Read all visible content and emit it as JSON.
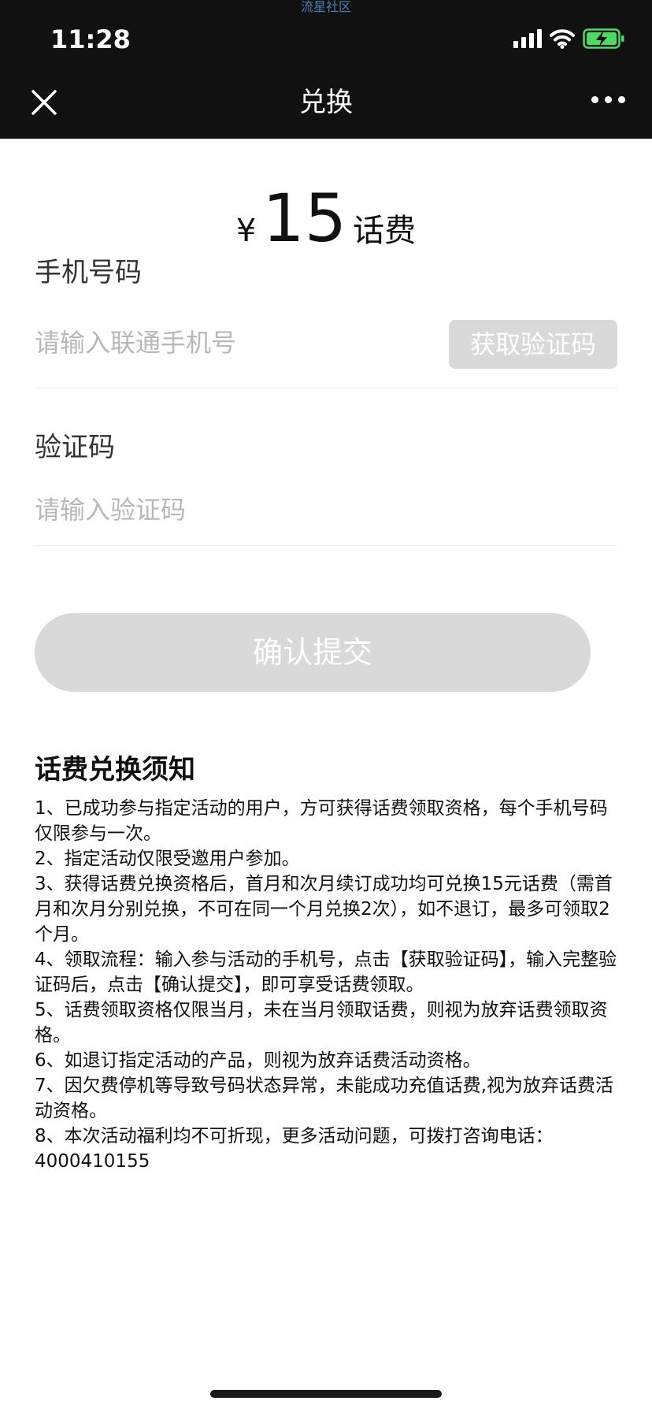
{
  "watermark": "流星社区",
  "status_bar": {
    "time": "11:28"
  },
  "nav": {
    "title": "兑换"
  },
  "amount": {
    "currency": "¥",
    "value": "15",
    "unit": "话费"
  },
  "form": {
    "phone_label": "手机号码",
    "phone_placeholder": "请输入联通手机号",
    "get_code_label": "获取验证码",
    "code_label": "验证码",
    "code_placeholder": "请输入验证码",
    "submit_label": "确认提交"
  },
  "notice": {
    "title": "话费兑换须知",
    "items": [
      "1、已成功参与指定活动的用户，方可获得话费领取资格，每个手机号码仅限参与一次。",
      "2、指定活动仅限受邀用户参加。",
      "3、获得话费兑换资格后，首月和次月续订成功均可兑换15元话费（需首月和次月分别兑换，不可在同一个月兑换2次），如不退订，最多可领取2个月。",
      "4、领取流程：输入参与活动的手机号，点击【获取验证码】，输入完整验证码后，点击【确认提交】，即可享受话费领取。",
      "5、话费领取资格仅限当月，未在当月领取话费，则视为放弃话费领取资格。",
      "6、如退订指定活动的产品，则视为放弃话费活动资格。",
      "7、因欠费停机等导致号码状态异常，未能成功充值话费,视为放弃话费活动资格。",
      "8、本次活动福利均不可折现，更多活动问题，可拨打咨询电话：4000410155"
    ]
  },
  "colors": {
    "topbar_bg": "#111111",
    "disabled_button": "#d9d9d9",
    "battery_green": "#4cd964"
  },
  "icons": {
    "close": "close-icon",
    "more": "more-icon",
    "signal": "signal-icon",
    "wifi": "wifi-icon",
    "battery": "battery-charging-icon"
  }
}
